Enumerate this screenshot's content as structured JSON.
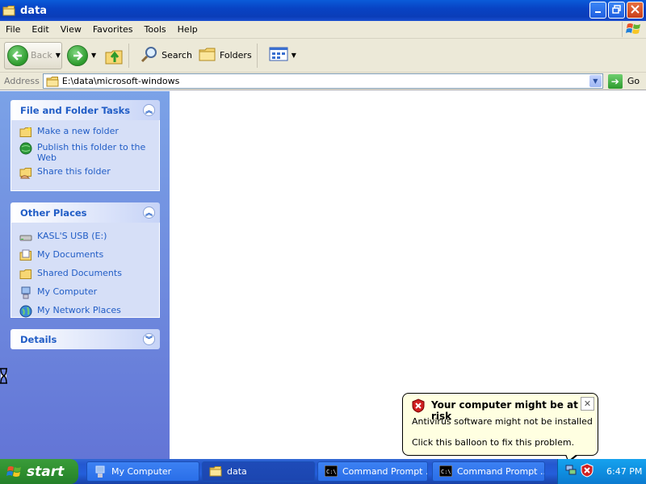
{
  "window": {
    "title": "data"
  },
  "menu": [
    "File",
    "Edit",
    "View",
    "Favorites",
    "Tools",
    "Help"
  ],
  "toolbar": {
    "back": "Back",
    "search": "Search",
    "folders": "Folders"
  },
  "address": {
    "label": "Address",
    "path": "E:\\data\\microsoft-windows",
    "go": "Go"
  },
  "panels": {
    "tasks": {
      "title": "File and Folder Tasks",
      "items": [
        "Make a new folder",
        "Publish this folder to the Web",
        "Share this folder"
      ]
    },
    "places": {
      "title": "Other Places",
      "items": [
        "KASL'S USB (E:)",
        "My Documents",
        "Shared Documents",
        "My Computer",
        "My Network Places"
      ]
    },
    "details": {
      "title": "Details"
    }
  },
  "balloon": {
    "title": "Your computer might be at risk",
    "line1": "Antivirus software might not be installed",
    "line2": "Click this balloon to fix this problem."
  },
  "taskbar": {
    "start": "start",
    "items": [
      "My Computer",
      "data",
      "Command Prompt ...",
      "Command Prompt ..."
    ],
    "time": "6:47 PM"
  },
  "icons": {
    "folder": "folder-icon",
    "back": "back-arrow-icon",
    "forward": "forward-arrow-icon",
    "up": "folder-up-icon",
    "search": "search-icon",
    "views": "views-icon",
    "warning": "security-shield-icon",
    "windows": "windows-logo-icon"
  }
}
